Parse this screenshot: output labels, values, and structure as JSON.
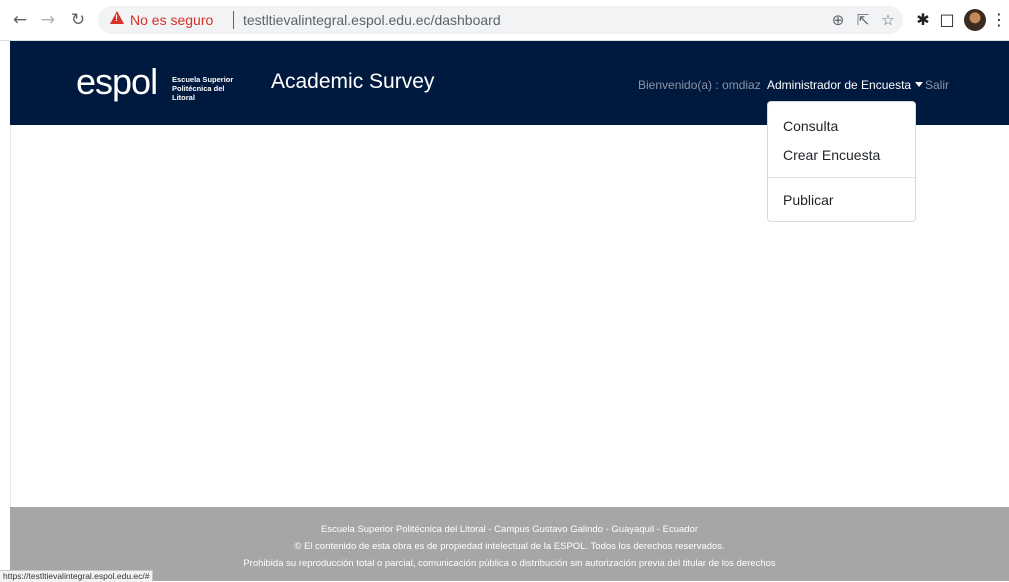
{
  "browser": {
    "security_label": "No es seguro",
    "url": "testltievalintegral.espol.edu.ec/dashboard",
    "back_icon": "←",
    "forward_icon": "→",
    "reload_icon": "↻",
    "zoom_icon": "⊕",
    "share_icon": "⇱",
    "star_icon": "☆",
    "extensions_icon": "✱",
    "sidepanel_icon": "□",
    "menu_icon": "⋮",
    "status_url": "https://testltievalintegral.espol.edu.ec/#"
  },
  "navbar": {
    "logo_word": "espol",
    "logo_sub_1": "Escuela Superior",
    "logo_sub_2": "Politécnica del Litoral",
    "brand": "Academic Survey",
    "welcome": "Bienvenido(a) : omdiaz",
    "admin_menu": "Administrador de Encuesta",
    "logout": "Salir"
  },
  "dropdown": {
    "items": [
      "Consulta",
      "Crear Encuesta",
      "Publicar"
    ]
  },
  "footer": {
    "line1": "Escuela Superior Politécnica del Litoral - Campus Gustavo Galindo - Guayaquil - Ecuador",
    "line2": "© El contenido de esta obra es de propiedad intelectual de la ESPOL. Todos los derechos reservados.",
    "line3": "Prohibida su reproducción total o parcial, comunicación pública o distribución sin autorización previa del titular de los derechos"
  },
  "colors": {
    "navbar_bg": "#001a3f",
    "footer_bg": "#a6a6a6",
    "insecure_red": "#d93025"
  }
}
